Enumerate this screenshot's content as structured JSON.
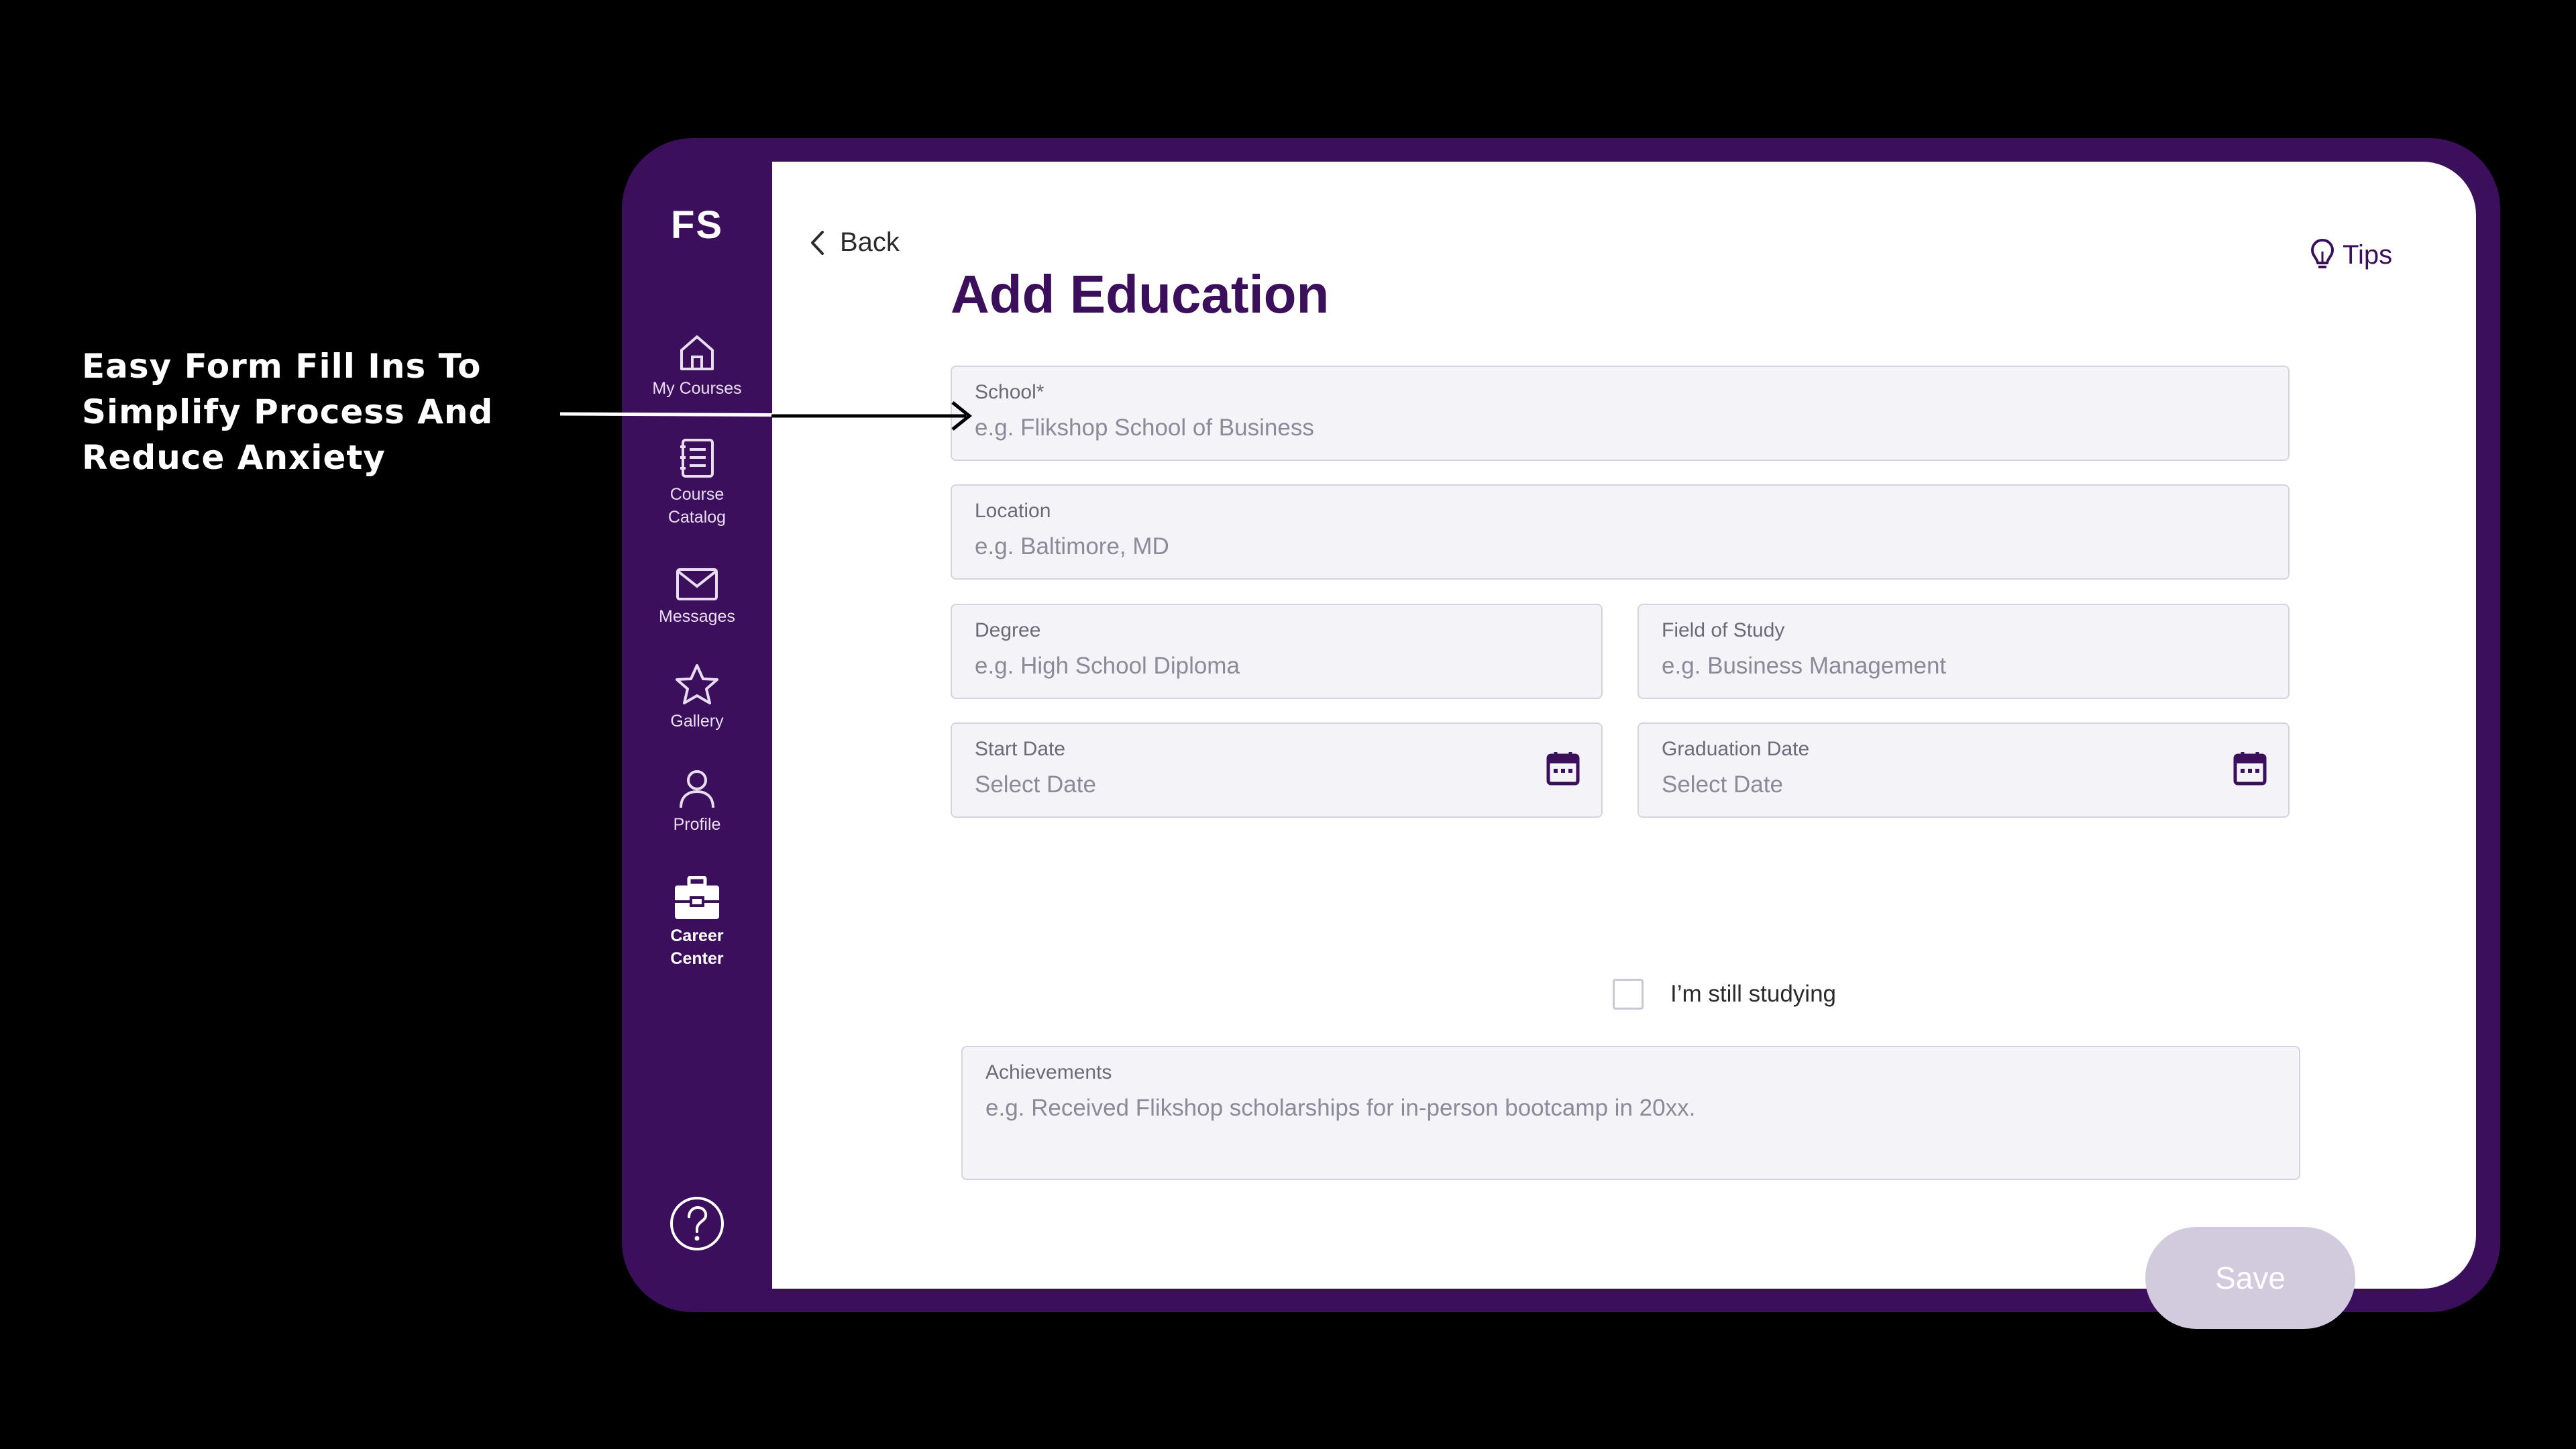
{
  "annotation": {
    "lines": [
      "Easy Form Fill Ins To",
      "Simplify Process And",
      "Reduce Anxiety"
    ]
  },
  "colors": {
    "brand_purple": "#3c0f5c",
    "field_bg": "#f4f3f8",
    "save_disabled": "#d2cbdd"
  },
  "sidebar": {
    "logo": "FS",
    "items": [
      {
        "label": "My Courses",
        "icon": "home-icon"
      },
      {
        "label_line1": "Course",
        "label_line2": "Catalog",
        "icon": "catalog-icon"
      },
      {
        "label": "Messages",
        "icon": "mail-icon"
      },
      {
        "label": "Gallery",
        "icon": "star-icon"
      },
      {
        "label": "Profile",
        "icon": "user-icon"
      },
      {
        "label_line1": "Career",
        "label_line2": "Center",
        "icon": "briefcase-icon",
        "active": true
      }
    ],
    "help_icon": "help-icon"
  },
  "header": {
    "back_label": "Back",
    "tips_label": "Tips",
    "title": "Add Education"
  },
  "form": {
    "school": {
      "label": "School*",
      "placeholder": "e.g. Flikshop School of Business"
    },
    "location": {
      "label": "Location",
      "placeholder": "e.g. Baltimore, MD"
    },
    "degree": {
      "label": "Degree",
      "placeholder": "e.g. High School Diploma"
    },
    "field_of_study": {
      "label": "Field of Study",
      "placeholder": "e.g. Business Management"
    },
    "start_date": {
      "label": "Start Date",
      "placeholder": "Select Date"
    },
    "graduation_date": {
      "label": "Graduation Date",
      "placeholder": "Select Date"
    },
    "still_studying": {
      "label": "I’m still studying",
      "checked": false
    },
    "achievements": {
      "label": "Achievements",
      "placeholder": "e.g. Received Flikshop scholarships for in-person bootcamp in 20xx."
    },
    "save_label": "Save"
  }
}
